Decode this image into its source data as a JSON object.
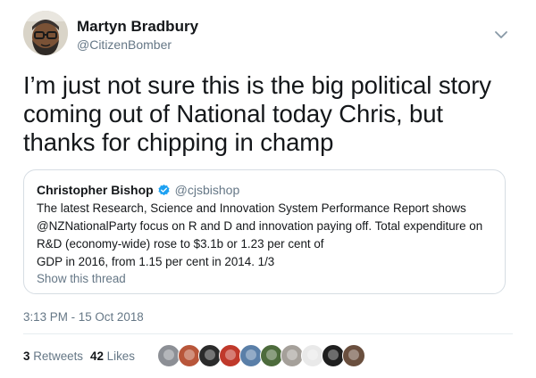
{
  "tweet": {
    "author_name": "Martyn Bradbury",
    "author_handle": "@CitizenBomber",
    "text": "I’m just not sure this is the big political story coming out of National today Chris, but thanks for chipping in champ",
    "timestamp": "3:13 PM - 15 Oct 2018",
    "avatar_icon": "avatar-bearded-man-with-glasses",
    "menu_icon": "chevron-down-icon"
  },
  "quoted": {
    "author_name": "Christopher Bishop",
    "author_handle": "@cjsbishop",
    "verified_icon": "verified-badge-icon",
    "lines": [
      "The latest Research, Science and Innovation System Performance Report shows",
      "@NZNationalParty focus on R and D and innovation paying off. Total expenditure on",
      "R&D (economy-wide) rose to $3.1b or 1.23 per cent of",
      "GDP in 2016, from 1.15 per cent in 2014. 1/3"
    ],
    "show_thread_label": "Show this thread"
  },
  "stats": {
    "retweets_count": "3",
    "retweets_label": "Retweets",
    "likes_count": "42",
    "likes_label": "Likes"
  },
  "likers": [
    {
      "color": "#8c8f95"
    },
    {
      "color": "#b8563a"
    },
    {
      "color": "#2b2b2b"
    },
    {
      "color": "#c0392b"
    },
    {
      "color": "#5a7fa8"
    },
    {
      "color": "#4d6b3c"
    },
    {
      "color": "#a5a09a"
    },
    {
      "color": "#e9e9e9"
    },
    {
      "color": "#1f1f1f"
    },
    {
      "color": "#6a4f3e"
    }
  ],
  "colors": {
    "text": "#14171a",
    "secondary": "#657786",
    "verified": "#1da1f2",
    "border": "#d6dde3"
  }
}
